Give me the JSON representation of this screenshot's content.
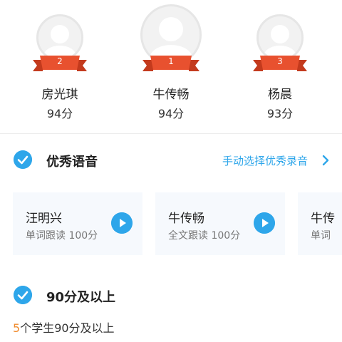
{
  "ranking": [
    {
      "rank": "2",
      "name": "房光琪",
      "score": "94分"
    },
    {
      "rank": "1",
      "name": "牛传畅",
      "score": "94分"
    },
    {
      "rank": "3",
      "name": "杨晨",
      "score": "93分"
    }
  ],
  "excellent_voice": {
    "title": "优秀语音",
    "manual_select_label": "手动选择优秀录音",
    "cards": [
      {
        "name": "汪明兴",
        "detail": "单词跟读  100分"
      },
      {
        "name": "牛传畅",
        "detail": "全文跟读  100分"
      },
      {
        "name": "牛传",
        "detail": "单词"
      }
    ]
  },
  "above_90": {
    "title": "90分及以上",
    "count": "5",
    "count_suffix": "个学生90分及以上"
  },
  "colors": {
    "accent_blue": "#2ea6ea",
    "ribbon_red": "#e8512f",
    "count_orange": "#f08a2c"
  },
  "icons": [
    "avatar-placeholder-icon",
    "rank-ribbon-icon",
    "check-circle-icon",
    "chevron-right-icon",
    "play-icon"
  ]
}
